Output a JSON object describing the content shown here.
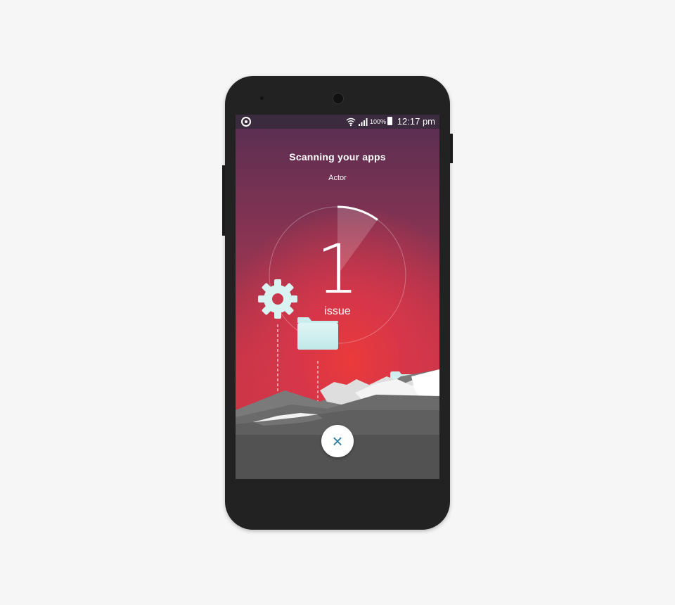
{
  "status_bar": {
    "battery": "100%",
    "time": "12:17 pm",
    "icons": [
      "app-icon",
      "wifi-icon",
      "signal-icon",
      "battery-icon"
    ]
  },
  "scan": {
    "title": "Scanning your apps",
    "current_app": "Actor",
    "issue_count": "1",
    "issue_label": "issue",
    "progress": 0.1
  },
  "actions": {
    "close_icon": "×"
  },
  "colors": {
    "accent": "#2f7f9e",
    "gradient_top": "#5c2f52",
    "gradient_bottom": "#e03a3a"
  }
}
